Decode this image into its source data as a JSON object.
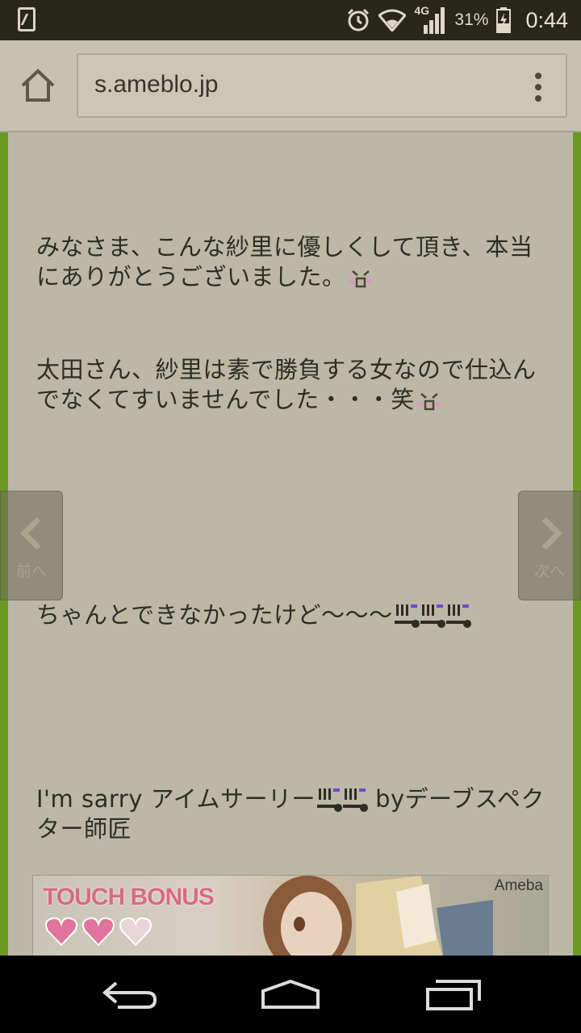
{
  "status_bar": {
    "network": "4G",
    "battery_percent": "31%",
    "time": "0:44"
  },
  "browser": {
    "url": "s.ameblo.jp"
  },
  "article": {
    "paragraphs": [
      "みなさま、こんな紗里に優しくして頂き、本当にありがとうございました。",
      "太田さん、紗里は素で勝負する女なので仕込んでなくてすいませんでした・・・笑",
      "ちゃんとできなかったけど〜〜〜",
      "I'm sarry アイムサーリー",
      "byデーブスペクター師匠"
    ]
  },
  "page_nav": {
    "prev_label": "前へ",
    "next_label": "次へ"
  },
  "banner": {
    "title": "TOUCH BONUS",
    "brand": "Ameba"
  },
  "colors": {
    "page_bg": "#bcb8a6",
    "accent_green": "#6a9a24",
    "status_bar_bg": "#29261a"
  }
}
